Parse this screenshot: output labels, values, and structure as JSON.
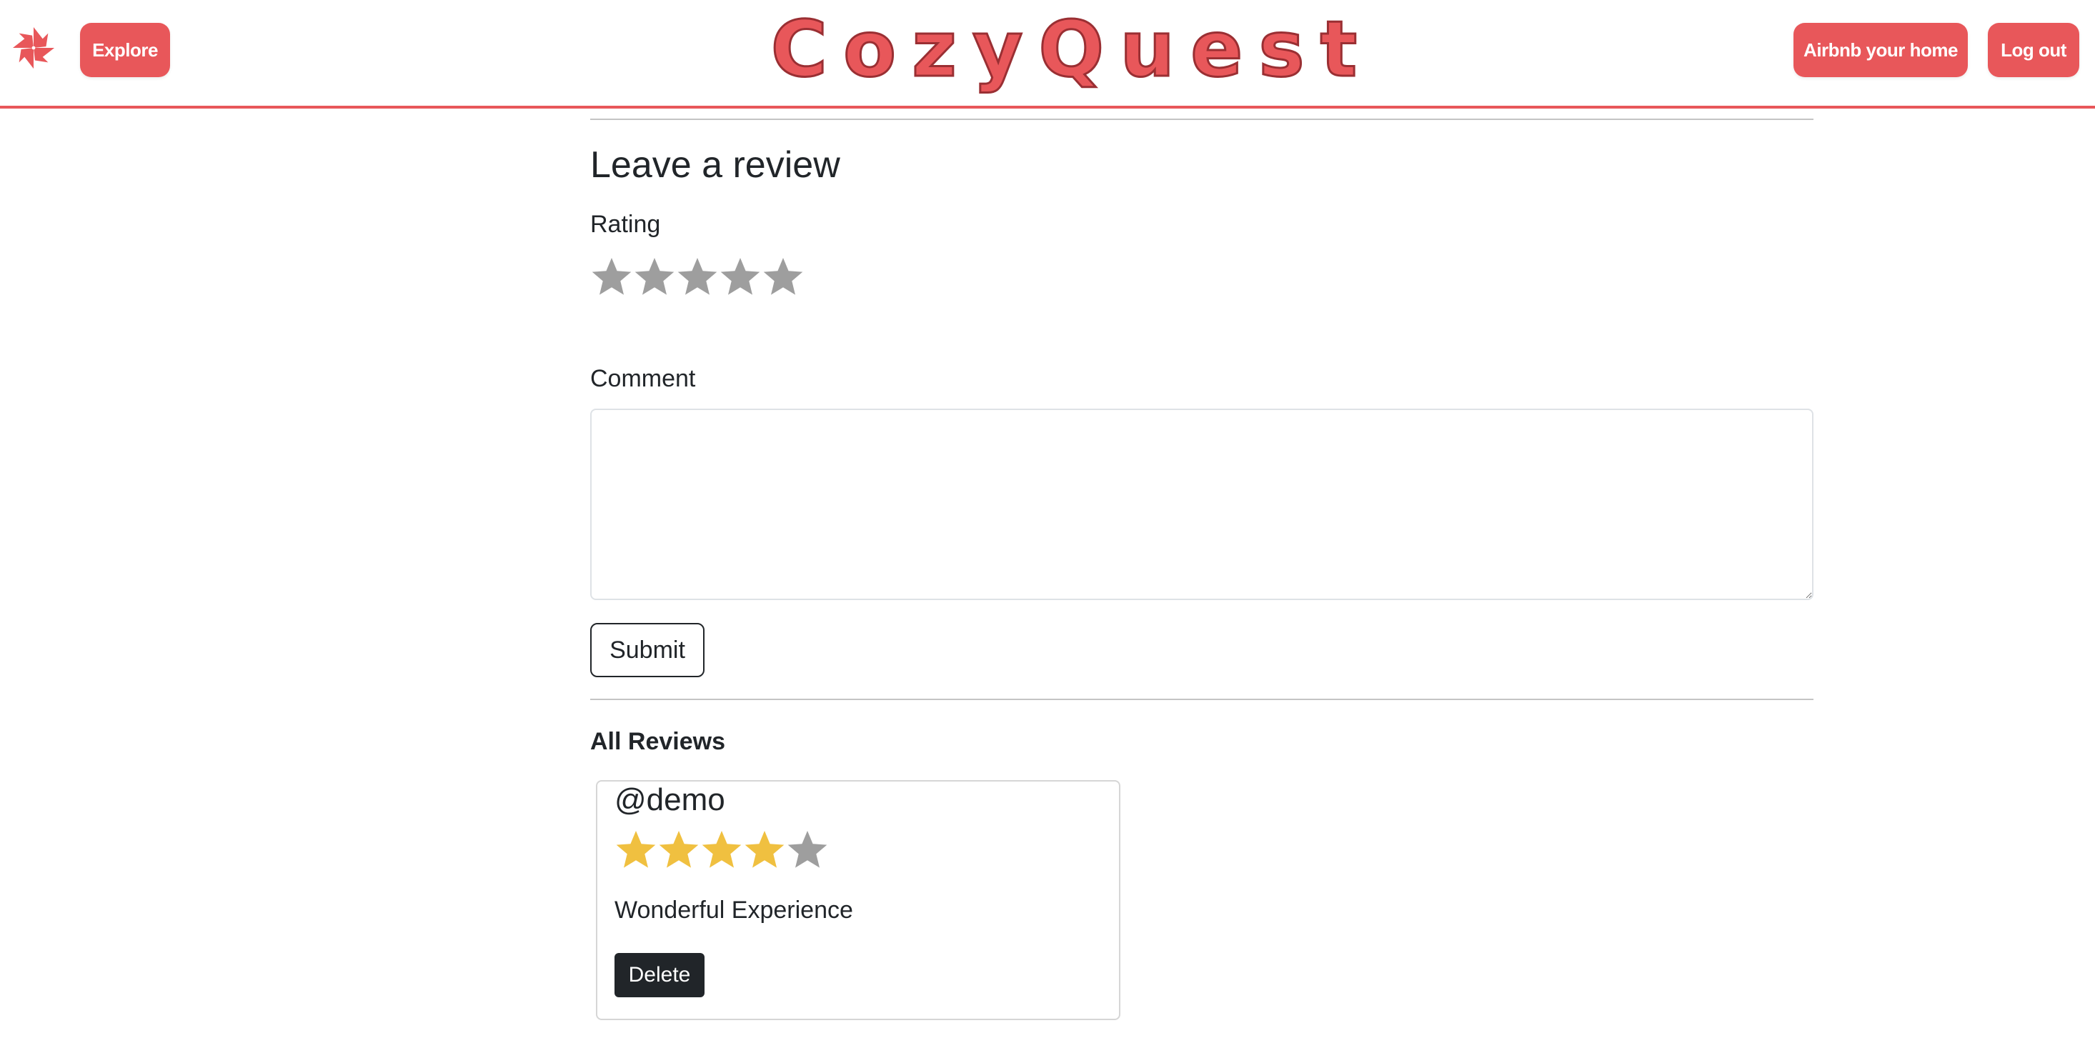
{
  "header": {
    "brand": "CozyQuest",
    "explore_label": "Explore",
    "host_label": "Airbnb your home",
    "logout_label": "Log out",
    "accent_color": "#e8575a"
  },
  "review_form": {
    "title": "Leave a review",
    "rating_label": "Rating",
    "rating_max": 5,
    "rating_value": 0,
    "comment_label": "Comment",
    "comment_value": "",
    "submit_label": "Submit"
  },
  "reviews_section": {
    "heading": "All Reviews",
    "reviews": [
      {
        "user": "@demo",
        "rating": 4,
        "rating_max": 5,
        "comment": "Wonderful Experience",
        "delete_label": "Delete"
      }
    ]
  },
  "colors": {
    "star_filled": "#f0c040",
    "star_empty": "#9e9e9e"
  },
  "icons": {
    "logo": "pinwheel-logo-icon",
    "rating_star": "star-icon"
  }
}
